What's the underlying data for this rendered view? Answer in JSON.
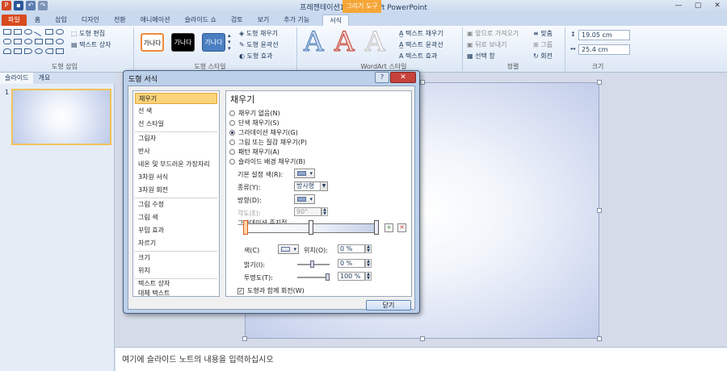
{
  "titlebar": {
    "title": "프레젠테이션1 - Microsoft PowerPoint",
    "context_tab": "그리기 도구"
  },
  "tabs": [
    {
      "label": "파일"
    },
    {
      "label": "홈"
    },
    {
      "label": "삽입"
    },
    {
      "label": "디자인"
    },
    {
      "label": "전환"
    },
    {
      "label": "애니메이션"
    },
    {
      "label": "슬라이드 쇼"
    },
    {
      "label": "검토"
    },
    {
      "label": "보기"
    },
    {
      "label": "추가 기능"
    },
    {
      "label": "서식"
    }
  ],
  "ribbon": {
    "insert_shapes": {
      "edit_shape": "도형 편집",
      "text_box": "텍스트 상자",
      "group": "도형 삽입"
    },
    "shape_styles": {
      "style_sample": "가나다",
      "fill": "도형 채우기",
      "outline": "도형 윤곽선",
      "effects": "도형 효과",
      "group": "도형 스타일"
    },
    "wordart": {
      "text_fill": "텍스트 채우기",
      "text_outline": "텍스트 윤곽선",
      "text_effects": "텍스트 효과",
      "group": "WordArt 스타일"
    },
    "arrange": {
      "bring_forward": "앞으로 가져오기",
      "send_backward": "뒤로 보내기",
      "selection_pane": "선택 창",
      "align": "맞춤",
      "group_btn": "그룹",
      "rotate": "회전",
      "group": "정렬"
    },
    "size": {
      "height": "19.05 cm",
      "width": "25.4 cm",
      "group": "크기"
    }
  },
  "leftpane": {
    "tab_slides": "슬라이드",
    "tab_outline": "개요",
    "slide_number": "1"
  },
  "notes": {
    "placeholder": "여기에 슬라이드 노트의 내용을 입력하십시오"
  },
  "dialog": {
    "title": "도형 서식",
    "categories": [
      "채우기",
      "선 색",
      "선 스타일",
      "그림자",
      "반사",
      "네온 및 부드러운 가장자리",
      "3차원 서식",
      "3차원 회전",
      "그림 수정",
      "그림 색",
      "꾸밈 효과",
      "자르기",
      "크기",
      "위치",
      "텍스트 상자",
      "대체 텍스트"
    ],
    "pane_title": "채우기",
    "fill_options": [
      "채우기 없음(N)",
      "단색 채우기(S)",
      "그라데이션 채우기(G)",
      "그림 또는 질감 채우기(P)",
      "패턴 채우기(A)",
      "슬라이드 배경 채우기(B)"
    ],
    "preset_label": "기본 설정 색(R):",
    "type_label": "종류(Y):",
    "type_value": "방사형",
    "direction_label": "방향(D):",
    "angle_label": "각도(E):",
    "angle_value": "90°",
    "stops_label": "그라데이션 중지점",
    "color_label": "색(C)",
    "position_label": "위치(O):",
    "position_value": "0 %",
    "brightness_label": "밝기(I):",
    "brightness_value": "0 %",
    "transparency_label": "투명도(T):",
    "transparency_value": "100 %",
    "rotate_label": "도형과 함께 회전(W)",
    "close_button": "닫기"
  }
}
